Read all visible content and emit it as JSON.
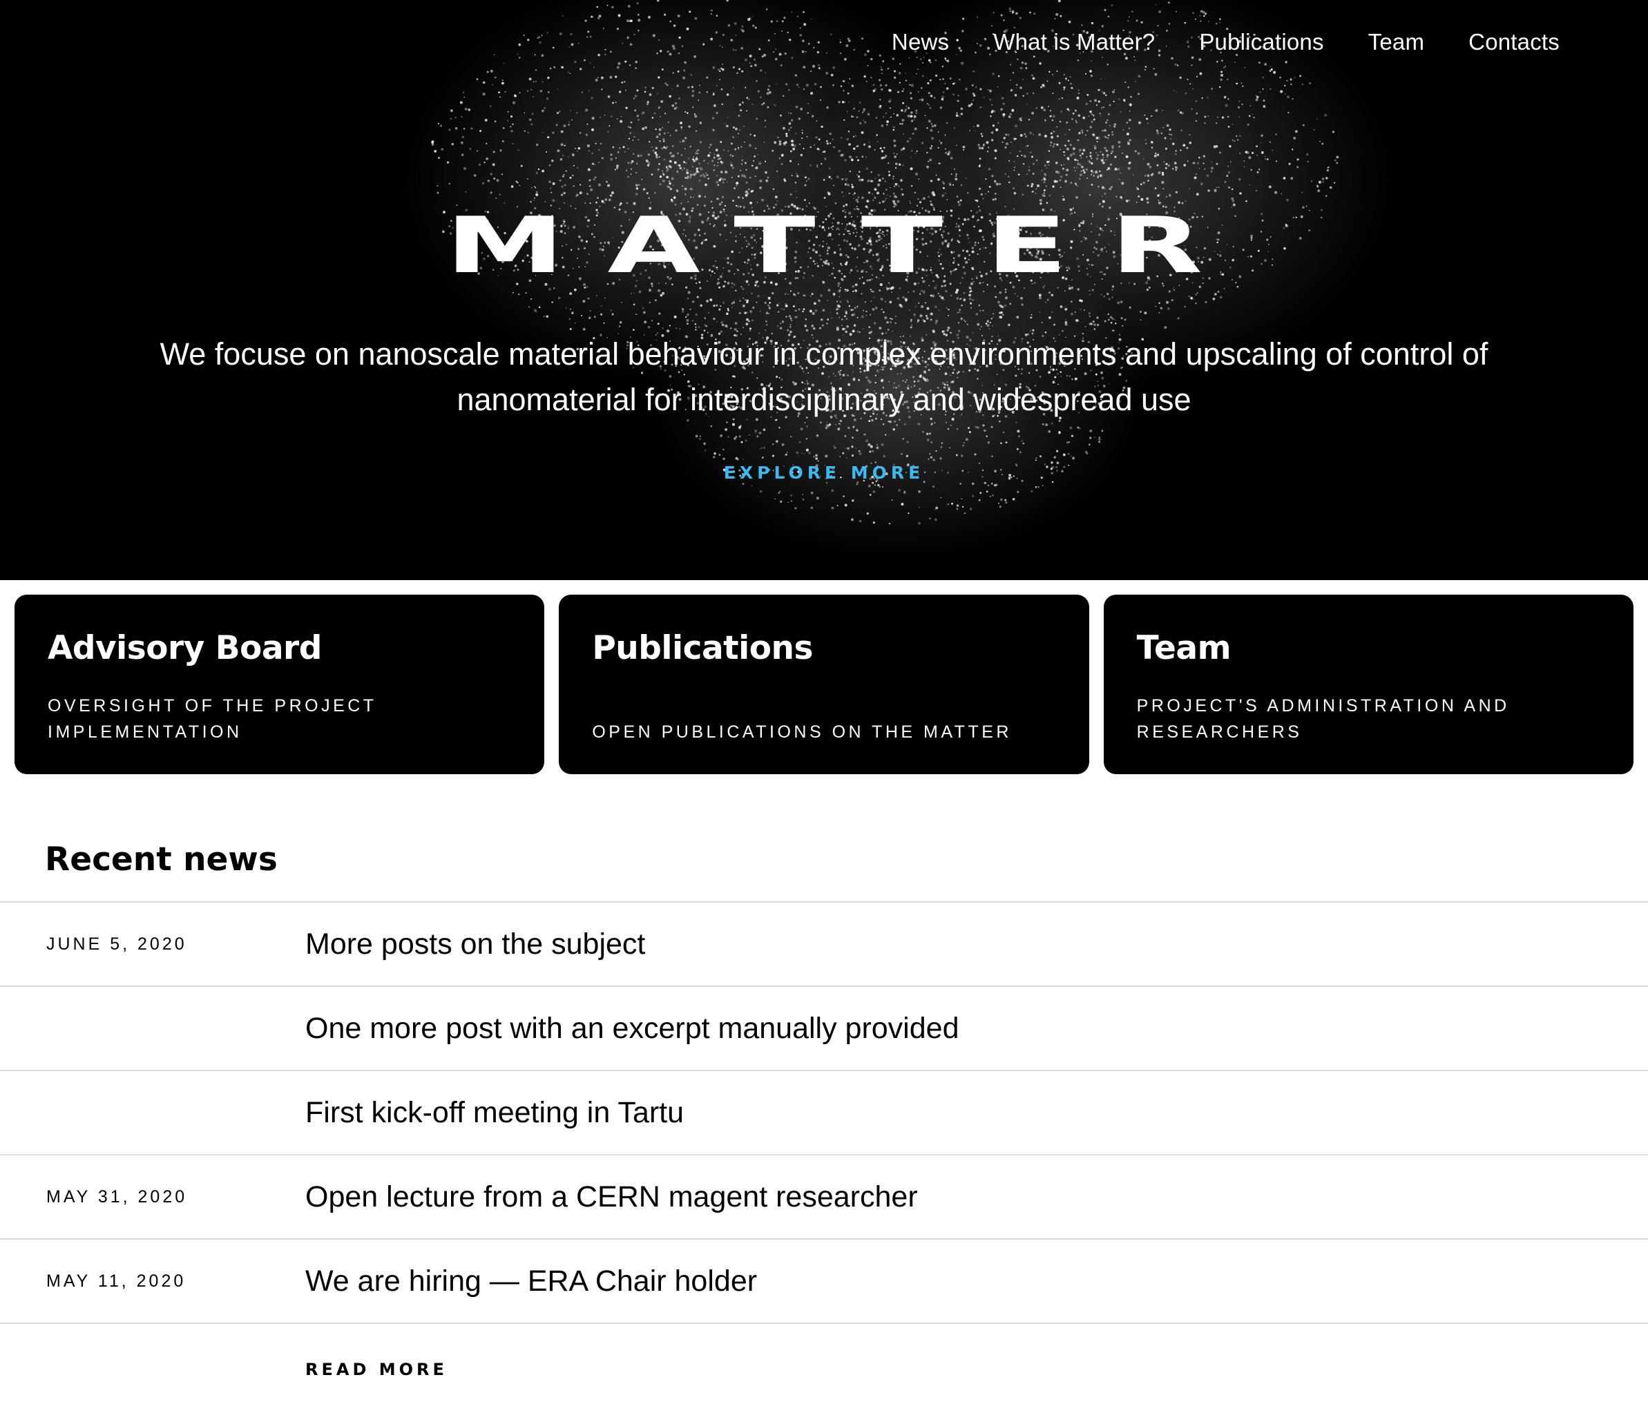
{
  "nav": {
    "items": [
      "News",
      "What is Matter?",
      "Publications",
      "Team",
      "Contacts"
    ]
  },
  "hero": {
    "logo": "MATTER",
    "lead_line1": "We focuse on nanoscale material behaviour in complex environments and upscaling of control of",
    "lead_line2": "nanomaterial for interdisciplinary and widespread use",
    "cta": "EXPLORE MORE",
    "cta_color": "#3fb8f0"
  },
  "cards": [
    {
      "title": "Advisory Board",
      "subtitle": "Oversight of the project implementation"
    },
    {
      "title": "Publications",
      "subtitle": "Open publications on the matter"
    },
    {
      "title": "Team",
      "subtitle": "Project's administration and researchers"
    }
  ],
  "news": {
    "heading": "Recent news",
    "items": [
      {
        "date": "June 5, 2020",
        "title": "More posts on the subject"
      },
      {
        "date": "",
        "title": "One more post with an excerpt manually provided"
      },
      {
        "date": "",
        "title": "First kick-off meeting in Tartu"
      },
      {
        "date": "May 31, 2020",
        "title": "Open lecture from a CERN magent researcher"
      },
      {
        "date": "May 11, 2020",
        "title": "We are hiring — ERA Chair holder"
      }
    ],
    "read_more": "READ MORE"
  }
}
